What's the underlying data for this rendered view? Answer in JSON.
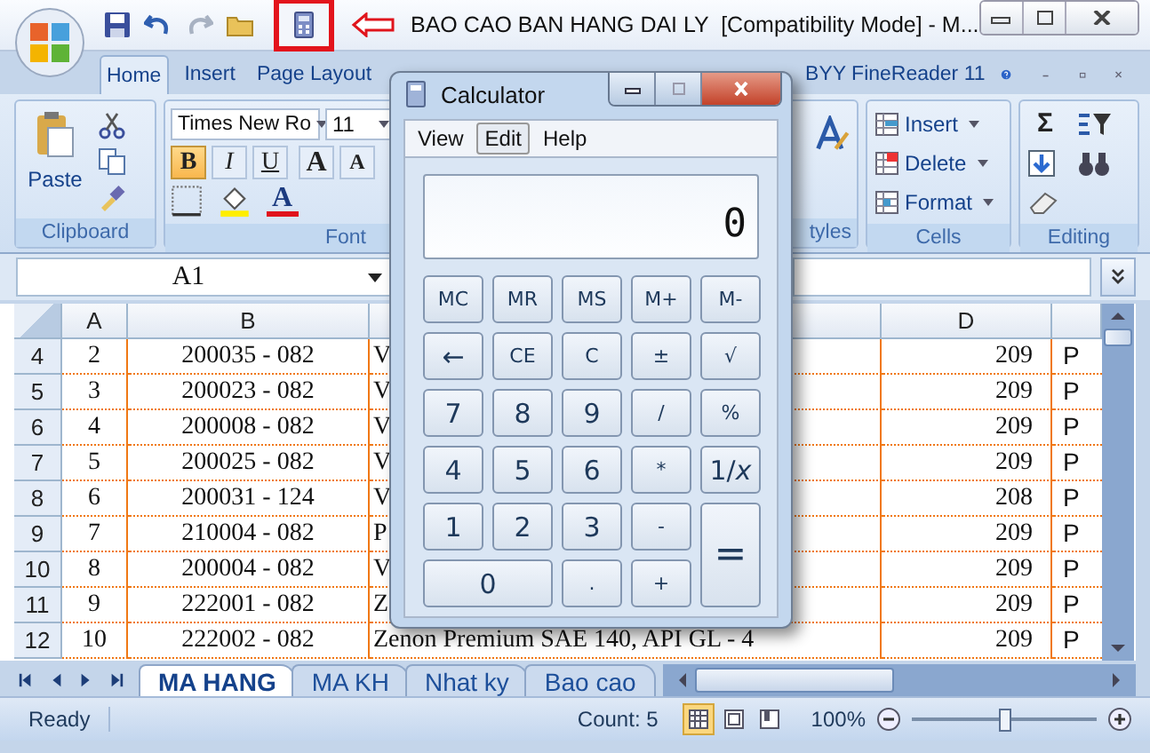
{
  "window": {
    "title": "BAO CAO BAN HANG DAI LY  [Compatibility Mode] - M..."
  },
  "ribbon_tabs": [
    {
      "label": "Home",
      "selected": true
    },
    {
      "label": "Insert",
      "selected": false
    },
    {
      "label": "Page Layout",
      "selected": false
    },
    {
      "label": "BYY FineReader 11",
      "selected": false
    }
  ],
  "clipboard": {
    "paste": "Paste",
    "label": "Clipboard"
  },
  "font": {
    "name": "Times New Ro",
    "size": "11",
    "label": "Font",
    "grow": "A",
    "shrink": "A",
    "color_button": "A",
    "styles": [
      {
        "label": "B",
        "selected": true
      },
      {
        "label": "I",
        "selected": false
      },
      {
        "label": "U",
        "selected": false
      }
    ]
  },
  "styles": {
    "label": "tyles"
  },
  "cells": {
    "label": "Cells",
    "commands": [
      "Insert",
      "Delete",
      "Format"
    ]
  },
  "editing": {
    "label": "Editing",
    "sum": "Σ"
  },
  "name_box": "A1",
  "headers": {
    "a": "A",
    "b": "B",
    "d": "D"
  },
  "rows": [
    {
      "num": "4",
      "a": "2",
      "b": "200035 - 082",
      "c": "V",
      "d": "209",
      "e": "P"
    },
    {
      "num": "5",
      "a": "3",
      "b": "200023 - 082",
      "c": "V",
      "d": "209",
      "e": "P"
    },
    {
      "num": "6",
      "a": "4",
      "b": "200008 - 082",
      "c": "V",
      "d": "209",
      "e": "P"
    },
    {
      "num": "7",
      "a": "5",
      "b": "200025 - 082",
      "c": "V",
      "d": "209",
      "e": "P"
    },
    {
      "num": "8",
      "a": "6",
      "b": "200031 - 124",
      "c": "V",
      "d": "208",
      "e": "P"
    },
    {
      "num": "9",
      "a": "7",
      "b": "210004 - 082",
      "c": "P",
      "d": "209",
      "e": "P"
    },
    {
      "num": "10",
      "a": "8",
      "b": "200004 - 082",
      "c": "V",
      "d": "209",
      "e": "P"
    },
    {
      "num": "11",
      "a": "9",
      "b": "222001 - 082",
      "c": "Z",
      "d": "209",
      "e": "P"
    },
    {
      "num": "12",
      "a": "10",
      "b": "222002 - 082",
      "c": "Zenon Premium SAE 140, API  GL - 4",
      "d": "209",
      "e": "P"
    }
  ],
  "sheet_tabs": [
    {
      "label": "MA HANG",
      "selected": true
    },
    {
      "label": "MA KH",
      "selected": false
    },
    {
      "label": "Nhat ky",
      "selected": false
    },
    {
      "label": "Bao cao",
      "selected": false
    }
  ],
  "status_bar": {
    "ready": "Ready",
    "count": "Count: 5",
    "zoom": "100%",
    "zoom_level": {
      "level": 0.5
    },
    "views": [
      {
        "selected": true
      },
      {
        "selected": false
      },
      {
        "selected": false
      }
    ]
  },
  "calculator": {
    "title": "Calculator",
    "menu": [
      {
        "label": "View",
        "selected": false
      },
      {
        "label": "Edit",
        "selected": true
      },
      {
        "label": "Help",
        "selected": false
      }
    ],
    "display": "0",
    "keys": [
      {
        "label": "MC",
        "kind": "small"
      },
      {
        "label": "MR",
        "kind": "small"
      },
      {
        "label": "MS",
        "kind": "small"
      },
      {
        "label": "M+",
        "kind": "small"
      },
      {
        "label": "M-",
        "kind": "small"
      },
      {
        "label": "←",
        "kind": "normal"
      },
      {
        "label": "CE",
        "kind": "small"
      },
      {
        "label": "C",
        "kind": "small"
      },
      {
        "label": "±",
        "kind": "small"
      },
      {
        "label": "√",
        "kind": "small"
      },
      {
        "label": "7",
        "kind": "normal"
      },
      {
        "label": "8",
        "kind": "normal"
      },
      {
        "label": "9",
        "kind": "normal"
      },
      {
        "label": "/",
        "kind": "small"
      },
      {
        "label": "%",
        "kind": "small"
      },
      {
        "label": "4",
        "kind": "normal"
      },
      {
        "label": "5",
        "kind": "normal"
      },
      {
        "label": "6",
        "kind": "normal"
      },
      {
        "label": "*",
        "kind": "small"
      },
      {
        "label": "1/*x*",
        "kind": "normal"
      },
      {
        "label": "1",
        "kind": "normal"
      },
      {
        "label": "2",
        "kind": "normal"
      },
      {
        "label": "3",
        "kind": "normal"
      },
      {
        "label": "-",
        "kind": "small"
      },
      {
        "label": "=",
        "kind": "tall"
      },
      {
        "label": "0",
        "kind": "wide"
      },
      {
        "label": ".",
        "kind": "small"
      },
      {
        "label": "+",
        "kind": "small"
      }
    ]
  }
}
